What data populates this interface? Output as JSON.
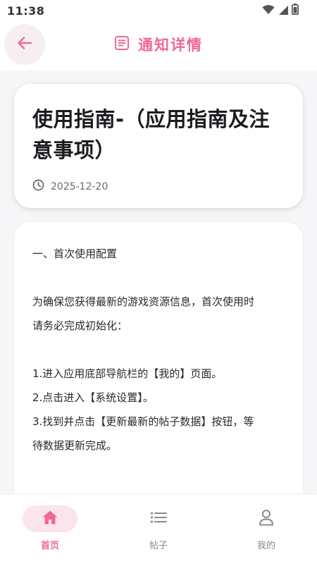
{
  "status_bar": {
    "time": "11:38",
    "icons": [
      "wifi-icon",
      "signal-icon",
      "battery-icon"
    ]
  },
  "header": {
    "back_icon": "arrow-left-icon",
    "title_icon": "document-icon",
    "title": "通知详情"
  },
  "notice": {
    "title_line1": "使用指南-（应用指南及注",
    "title_line2": "意事项）",
    "date_icon": "clock-icon",
    "date": "2025-12-20",
    "body": {
      "section1_heading": "一、首次使用配置",
      "intro_line1": "为确保您获得最新的游戏资源信息，首次使用时",
      "intro_line2": "请务必完成初始化：",
      "step1": "1.进入应用底部导航栏的【我的】页面。",
      "step2": "2.点击进入【系统设置】。",
      "step3_line1": "3.找到并点击【更新最新的帖子数据】按钮，等",
      "step3_line2": "待数据更新完成。"
    }
  },
  "bottom_nav": {
    "items": [
      {
        "label": "首页",
        "icon": "home-icon",
        "active": true
      },
      {
        "label": "帖子",
        "icon": "list-icon",
        "active": false
      },
      {
        "label": "我的",
        "icon": "user-icon",
        "active": false
      }
    ]
  },
  "colors": {
    "accent": "#f0679a",
    "accent_light": "#fbe4ec",
    "background": "#f6f6f8",
    "card": "#ffffff"
  }
}
